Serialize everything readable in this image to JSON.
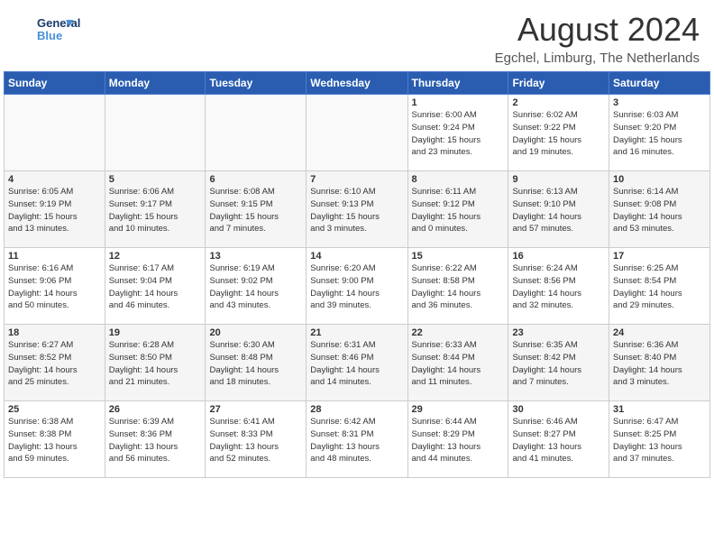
{
  "header": {
    "logo_general": "General",
    "logo_blue": "Blue",
    "month": "August 2024",
    "location": "Egchel, Limburg, The Netherlands"
  },
  "weekdays": [
    "Sunday",
    "Monday",
    "Tuesday",
    "Wednesday",
    "Thursday",
    "Friday",
    "Saturday"
  ],
  "weeks": [
    [
      {
        "day": "",
        "info": "",
        "empty": true
      },
      {
        "day": "",
        "info": "",
        "empty": true
      },
      {
        "day": "",
        "info": "",
        "empty": true
      },
      {
        "day": "",
        "info": "",
        "empty": true
      },
      {
        "day": "1",
        "info": "Sunrise: 6:00 AM\nSunset: 9:24 PM\nDaylight: 15 hours\nand 23 minutes."
      },
      {
        "day": "2",
        "info": "Sunrise: 6:02 AM\nSunset: 9:22 PM\nDaylight: 15 hours\nand 19 minutes."
      },
      {
        "day": "3",
        "info": "Sunrise: 6:03 AM\nSunset: 9:20 PM\nDaylight: 15 hours\nand 16 minutes."
      }
    ],
    [
      {
        "day": "4",
        "info": "Sunrise: 6:05 AM\nSunset: 9:19 PM\nDaylight: 15 hours\nand 13 minutes."
      },
      {
        "day": "5",
        "info": "Sunrise: 6:06 AM\nSunset: 9:17 PM\nDaylight: 15 hours\nand 10 minutes."
      },
      {
        "day": "6",
        "info": "Sunrise: 6:08 AM\nSunset: 9:15 PM\nDaylight: 15 hours\nand 7 minutes."
      },
      {
        "day": "7",
        "info": "Sunrise: 6:10 AM\nSunset: 9:13 PM\nDaylight: 15 hours\nand 3 minutes."
      },
      {
        "day": "8",
        "info": "Sunrise: 6:11 AM\nSunset: 9:12 PM\nDaylight: 15 hours\nand 0 minutes."
      },
      {
        "day": "9",
        "info": "Sunrise: 6:13 AM\nSunset: 9:10 PM\nDaylight: 14 hours\nand 57 minutes."
      },
      {
        "day": "10",
        "info": "Sunrise: 6:14 AM\nSunset: 9:08 PM\nDaylight: 14 hours\nand 53 minutes."
      }
    ],
    [
      {
        "day": "11",
        "info": "Sunrise: 6:16 AM\nSunset: 9:06 PM\nDaylight: 14 hours\nand 50 minutes."
      },
      {
        "day": "12",
        "info": "Sunrise: 6:17 AM\nSunset: 9:04 PM\nDaylight: 14 hours\nand 46 minutes."
      },
      {
        "day": "13",
        "info": "Sunrise: 6:19 AM\nSunset: 9:02 PM\nDaylight: 14 hours\nand 43 minutes."
      },
      {
        "day": "14",
        "info": "Sunrise: 6:20 AM\nSunset: 9:00 PM\nDaylight: 14 hours\nand 39 minutes."
      },
      {
        "day": "15",
        "info": "Sunrise: 6:22 AM\nSunset: 8:58 PM\nDaylight: 14 hours\nand 36 minutes."
      },
      {
        "day": "16",
        "info": "Sunrise: 6:24 AM\nSunset: 8:56 PM\nDaylight: 14 hours\nand 32 minutes."
      },
      {
        "day": "17",
        "info": "Sunrise: 6:25 AM\nSunset: 8:54 PM\nDaylight: 14 hours\nand 29 minutes."
      }
    ],
    [
      {
        "day": "18",
        "info": "Sunrise: 6:27 AM\nSunset: 8:52 PM\nDaylight: 14 hours\nand 25 minutes."
      },
      {
        "day": "19",
        "info": "Sunrise: 6:28 AM\nSunset: 8:50 PM\nDaylight: 14 hours\nand 21 minutes."
      },
      {
        "day": "20",
        "info": "Sunrise: 6:30 AM\nSunset: 8:48 PM\nDaylight: 14 hours\nand 18 minutes."
      },
      {
        "day": "21",
        "info": "Sunrise: 6:31 AM\nSunset: 8:46 PM\nDaylight: 14 hours\nand 14 minutes."
      },
      {
        "day": "22",
        "info": "Sunrise: 6:33 AM\nSunset: 8:44 PM\nDaylight: 14 hours\nand 11 minutes."
      },
      {
        "day": "23",
        "info": "Sunrise: 6:35 AM\nSunset: 8:42 PM\nDaylight: 14 hours\nand 7 minutes."
      },
      {
        "day": "24",
        "info": "Sunrise: 6:36 AM\nSunset: 8:40 PM\nDaylight: 14 hours\nand 3 minutes."
      }
    ],
    [
      {
        "day": "25",
        "info": "Sunrise: 6:38 AM\nSunset: 8:38 PM\nDaylight: 13 hours\nand 59 minutes."
      },
      {
        "day": "26",
        "info": "Sunrise: 6:39 AM\nSunset: 8:36 PM\nDaylight: 13 hours\nand 56 minutes."
      },
      {
        "day": "27",
        "info": "Sunrise: 6:41 AM\nSunset: 8:33 PM\nDaylight: 13 hours\nand 52 minutes."
      },
      {
        "day": "28",
        "info": "Sunrise: 6:42 AM\nSunset: 8:31 PM\nDaylight: 13 hours\nand 48 minutes."
      },
      {
        "day": "29",
        "info": "Sunrise: 6:44 AM\nSunset: 8:29 PM\nDaylight: 13 hours\nand 44 minutes."
      },
      {
        "day": "30",
        "info": "Sunrise: 6:46 AM\nSunset: 8:27 PM\nDaylight: 13 hours\nand 41 minutes."
      },
      {
        "day": "31",
        "info": "Sunrise: 6:47 AM\nSunset: 8:25 PM\nDaylight: 13 hours\nand 37 minutes."
      }
    ]
  ]
}
